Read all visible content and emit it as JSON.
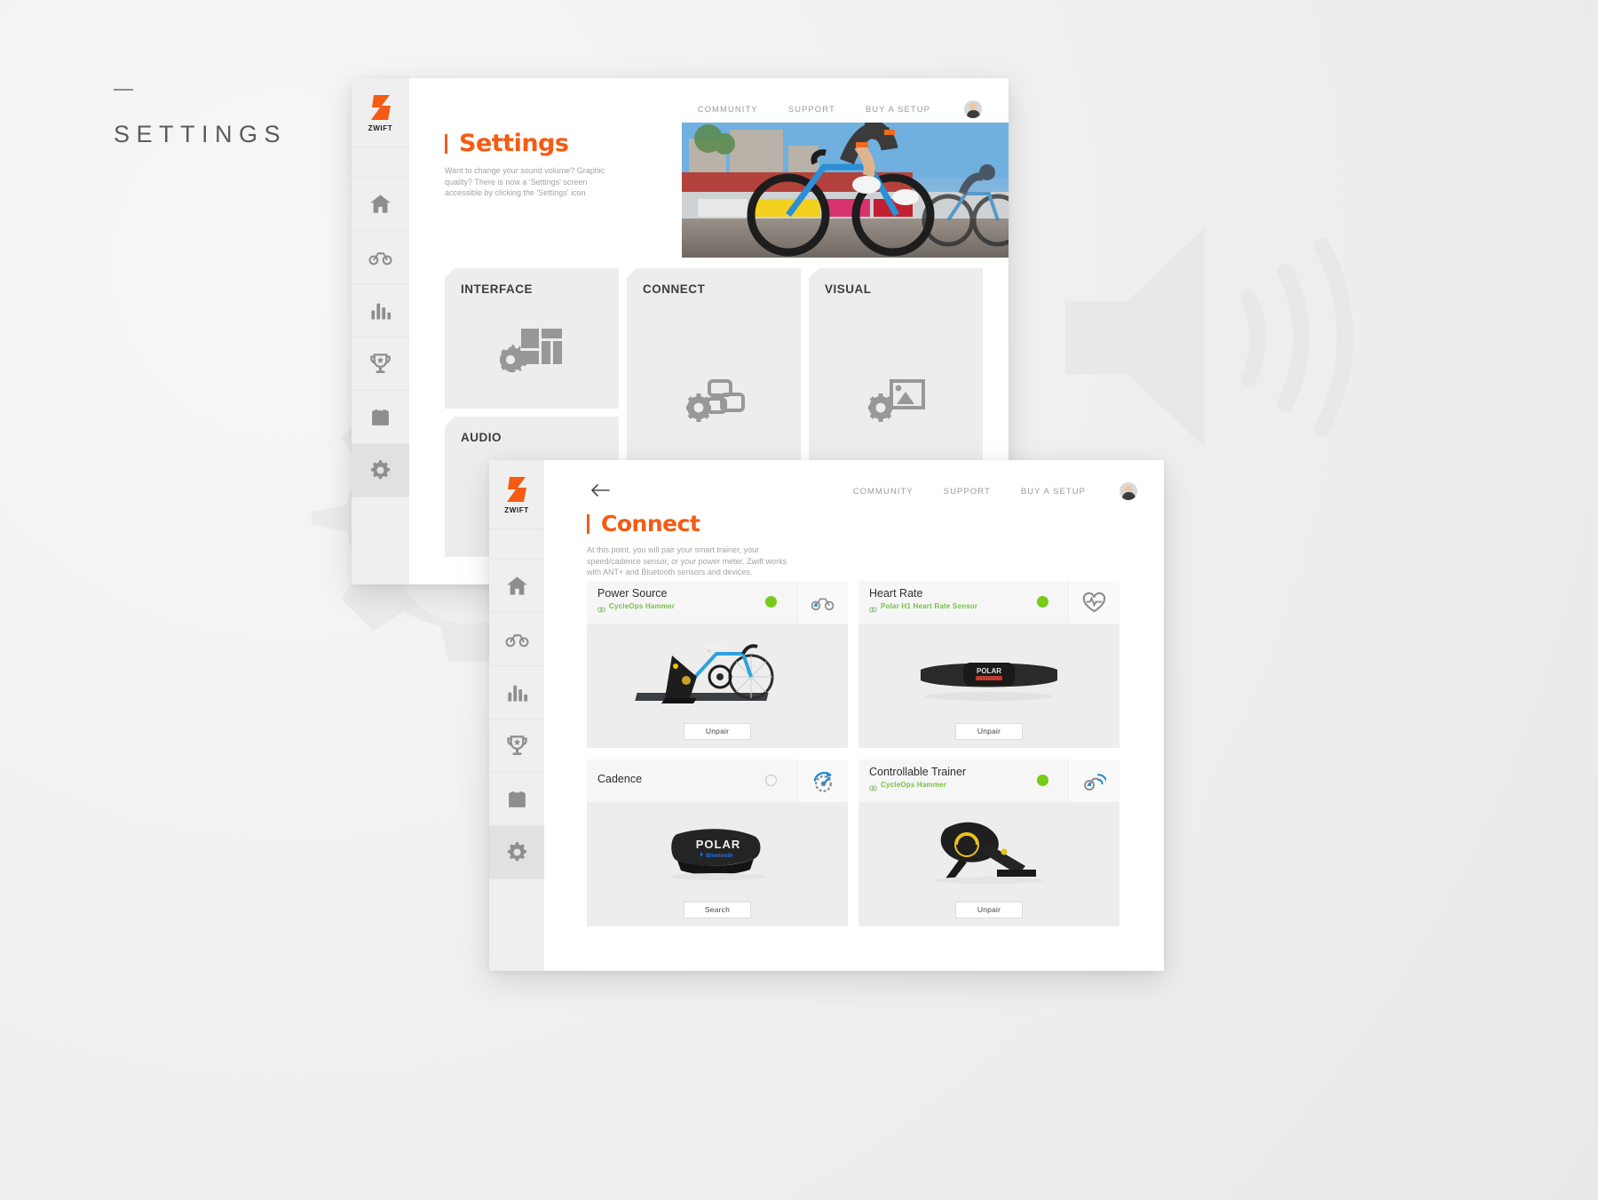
{
  "page_label": {
    "dash": "–",
    "title": "SETTINGS"
  },
  "brand": {
    "wordmark": "ZWIFT"
  },
  "settings_window": {
    "nav": [
      {
        "label": "COMMUNITY"
      },
      {
        "label": "SUPPORT"
      },
      {
        "label": "BUY A SETUP"
      }
    ],
    "avatar_name": "user-avatar",
    "title": "Settings",
    "description": "Want to change your sound volume? Graphic quality? There is now a 'Settings' screen accessible by clicking the 'Settings' icon",
    "hero_alt": "Zwift cyclists racing in a virtual city",
    "sidebar": [
      {
        "name": "home",
        "icon": "home-icon"
      },
      {
        "name": "ride",
        "icon": "bicycle-icon"
      },
      {
        "name": "activity",
        "icon": "bar-chart-icon"
      },
      {
        "name": "achievements",
        "icon": "trophy-icon"
      },
      {
        "name": "garage",
        "icon": "jersey-icon"
      },
      {
        "name": "settings",
        "icon": "gear-icon",
        "active": true
      }
    ],
    "cards": [
      {
        "title": "INTERFACE",
        "icon": "gear-layout-icon"
      },
      {
        "title": "AUDIO",
        "icon": ""
      },
      {
        "title": "CONNECT",
        "icon": "gear-link-icon"
      },
      {
        "title": "VISUAL",
        "icon": "gear-image-icon"
      }
    ]
  },
  "connect_window": {
    "nav": [
      {
        "label": "COMMUNITY"
      },
      {
        "label": "SUPPORT"
      },
      {
        "label": "BUY A SETUP"
      }
    ],
    "back_label": "back-arrow",
    "title": "Connect",
    "description": "At this point, you will pair your smart trainer, your speed/cadence sensor, or your power meter. Zwift works with ANT+ and Bluetooth sensors and devices.",
    "sidebar": [
      {
        "name": "home",
        "icon": "home-icon"
      },
      {
        "name": "ride",
        "icon": "bicycle-icon"
      },
      {
        "name": "activity",
        "icon": "bar-chart-icon"
      },
      {
        "name": "achievements",
        "icon": "trophy-icon"
      },
      {
        "name": "garage",
        "icon": "jersey-icon"
      },
      {
        "name": "settings",
        "icon": "gear-icon",
        "active": true
      }
    ],
    "devices": [
      {
        "name": "Power Source",
        "device": "CycleOps Hammer",
        "connected": true,
        "icon": "power-bike-icon",
        "photo": "bike-on-trainer",
        "button": "Unpair"
      },
      {
        "name": "Heart Rate",
        "device": "Polar H1 Heart Rate Sensor",
        "connected": true,
        "icon": "heart-pulse-icon",
        "photo": "heart-rate-strap",
        "button": "Unpair"
      },
      {
        "name": "Cadence",
        "device": "",
        "connected": false,
        "icon": "cadence-icon",
        "photo": "polar-cadence-sensor",
        "button": "Search"
      },
      {
        "name": "Controllable Trainer",
        "device": "CycleOps Hammer",
        "connected": true,
        "icon": "trainer-signal-icon",
        "photo": "cycleops-hammer-trainer",
        "button": "Unpair"
      }
    ]
  },
  "colors": {
    "accent": "#f45b13",
    "connected": "#76cc18",
    "device_text": "#76c043",
    "card_bg": "#ededed",
    "sidebar_bg": "#efefef"
  }
}
